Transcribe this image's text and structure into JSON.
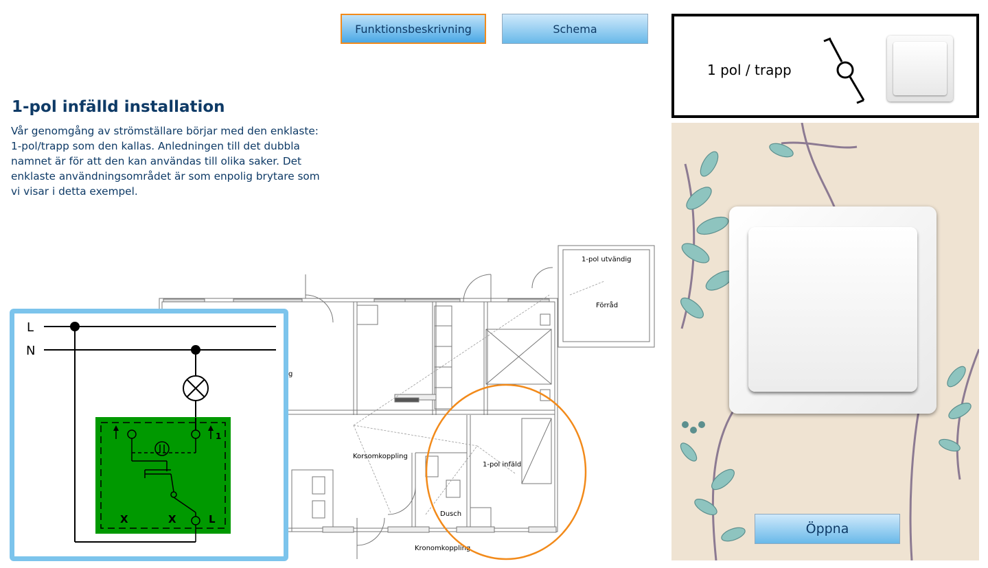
{
  "tabs": {
    "function_label": "Funktionsbeskrivning",
    "schema_label": "Schema"
  },
  "content": {
    "title": "1-pol infälld installation",
    "description": "Vår genomgång av strömställare börjar med den enklaste: 1-pol/trapp som den kallas. Anledningen till det dubbla namnet är för att den kan användas till olika saker. Det enklaste användningsområdet är som enpolig brytare som vi visar i detta exempel."
  },
  "floorplan": {
    "labels": {
      "outdoor": "1-pol utvändig",
      "storage": "Förråd",
      "cross": "Korsomkoppling",
      "recessed": "1-pol infäld",
      "shower": "Dusch",
      "chandelier": "Kronomkoppling",
      "partial": "g"
    },
    "highlight_color": "#f28a1a"
  },
  "wiring": {
    "line_label": "L",
    "neutral_label": "N",
    "terminal_x1": "X",
    "terminal_x2": "X",
    "terminal_l": "L",
    "mark_one": "1",
    "device_color": "#009900",
    "frame_color": "#7cc4ec"
  },
  "legend": {
    "label": "1 pol / trapp"
  },
  "preview": {
    "open_label": "Öppna"
  },
  "colors": {
    "accent": "#f28a1a",
    "text": "#0e3a66",
    "button": "#69b9e9"
  }
}
